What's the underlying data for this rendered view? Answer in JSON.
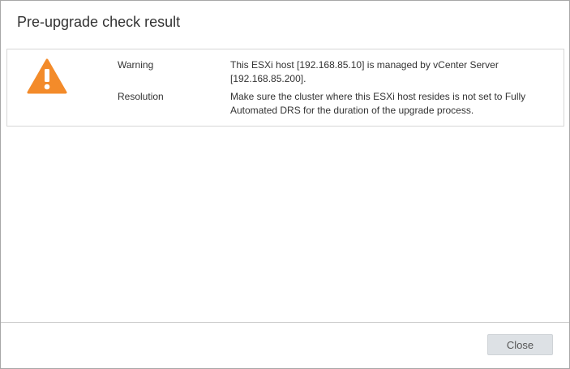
{
  "dialog": {
    "title": "Pre-upgrade check result"
  },
  "result": {
    "icon": "warning-triangle-icon",
    "icon_color": "#f38b2a",
    "warning_label": "Warning",
    "warning_text": "This ESXi host [192.168.85.10] is managed by vCenter Server [192.168.85.200].",
    "resolution_label": "Resolution",
    "resolution_text": "Make sure the cluster where this ESXi host resides is not set to Fully Automated DRS for the duration of the upgrade process."
  },
  "footer": {
    "close_label": "Close"
  }
}
